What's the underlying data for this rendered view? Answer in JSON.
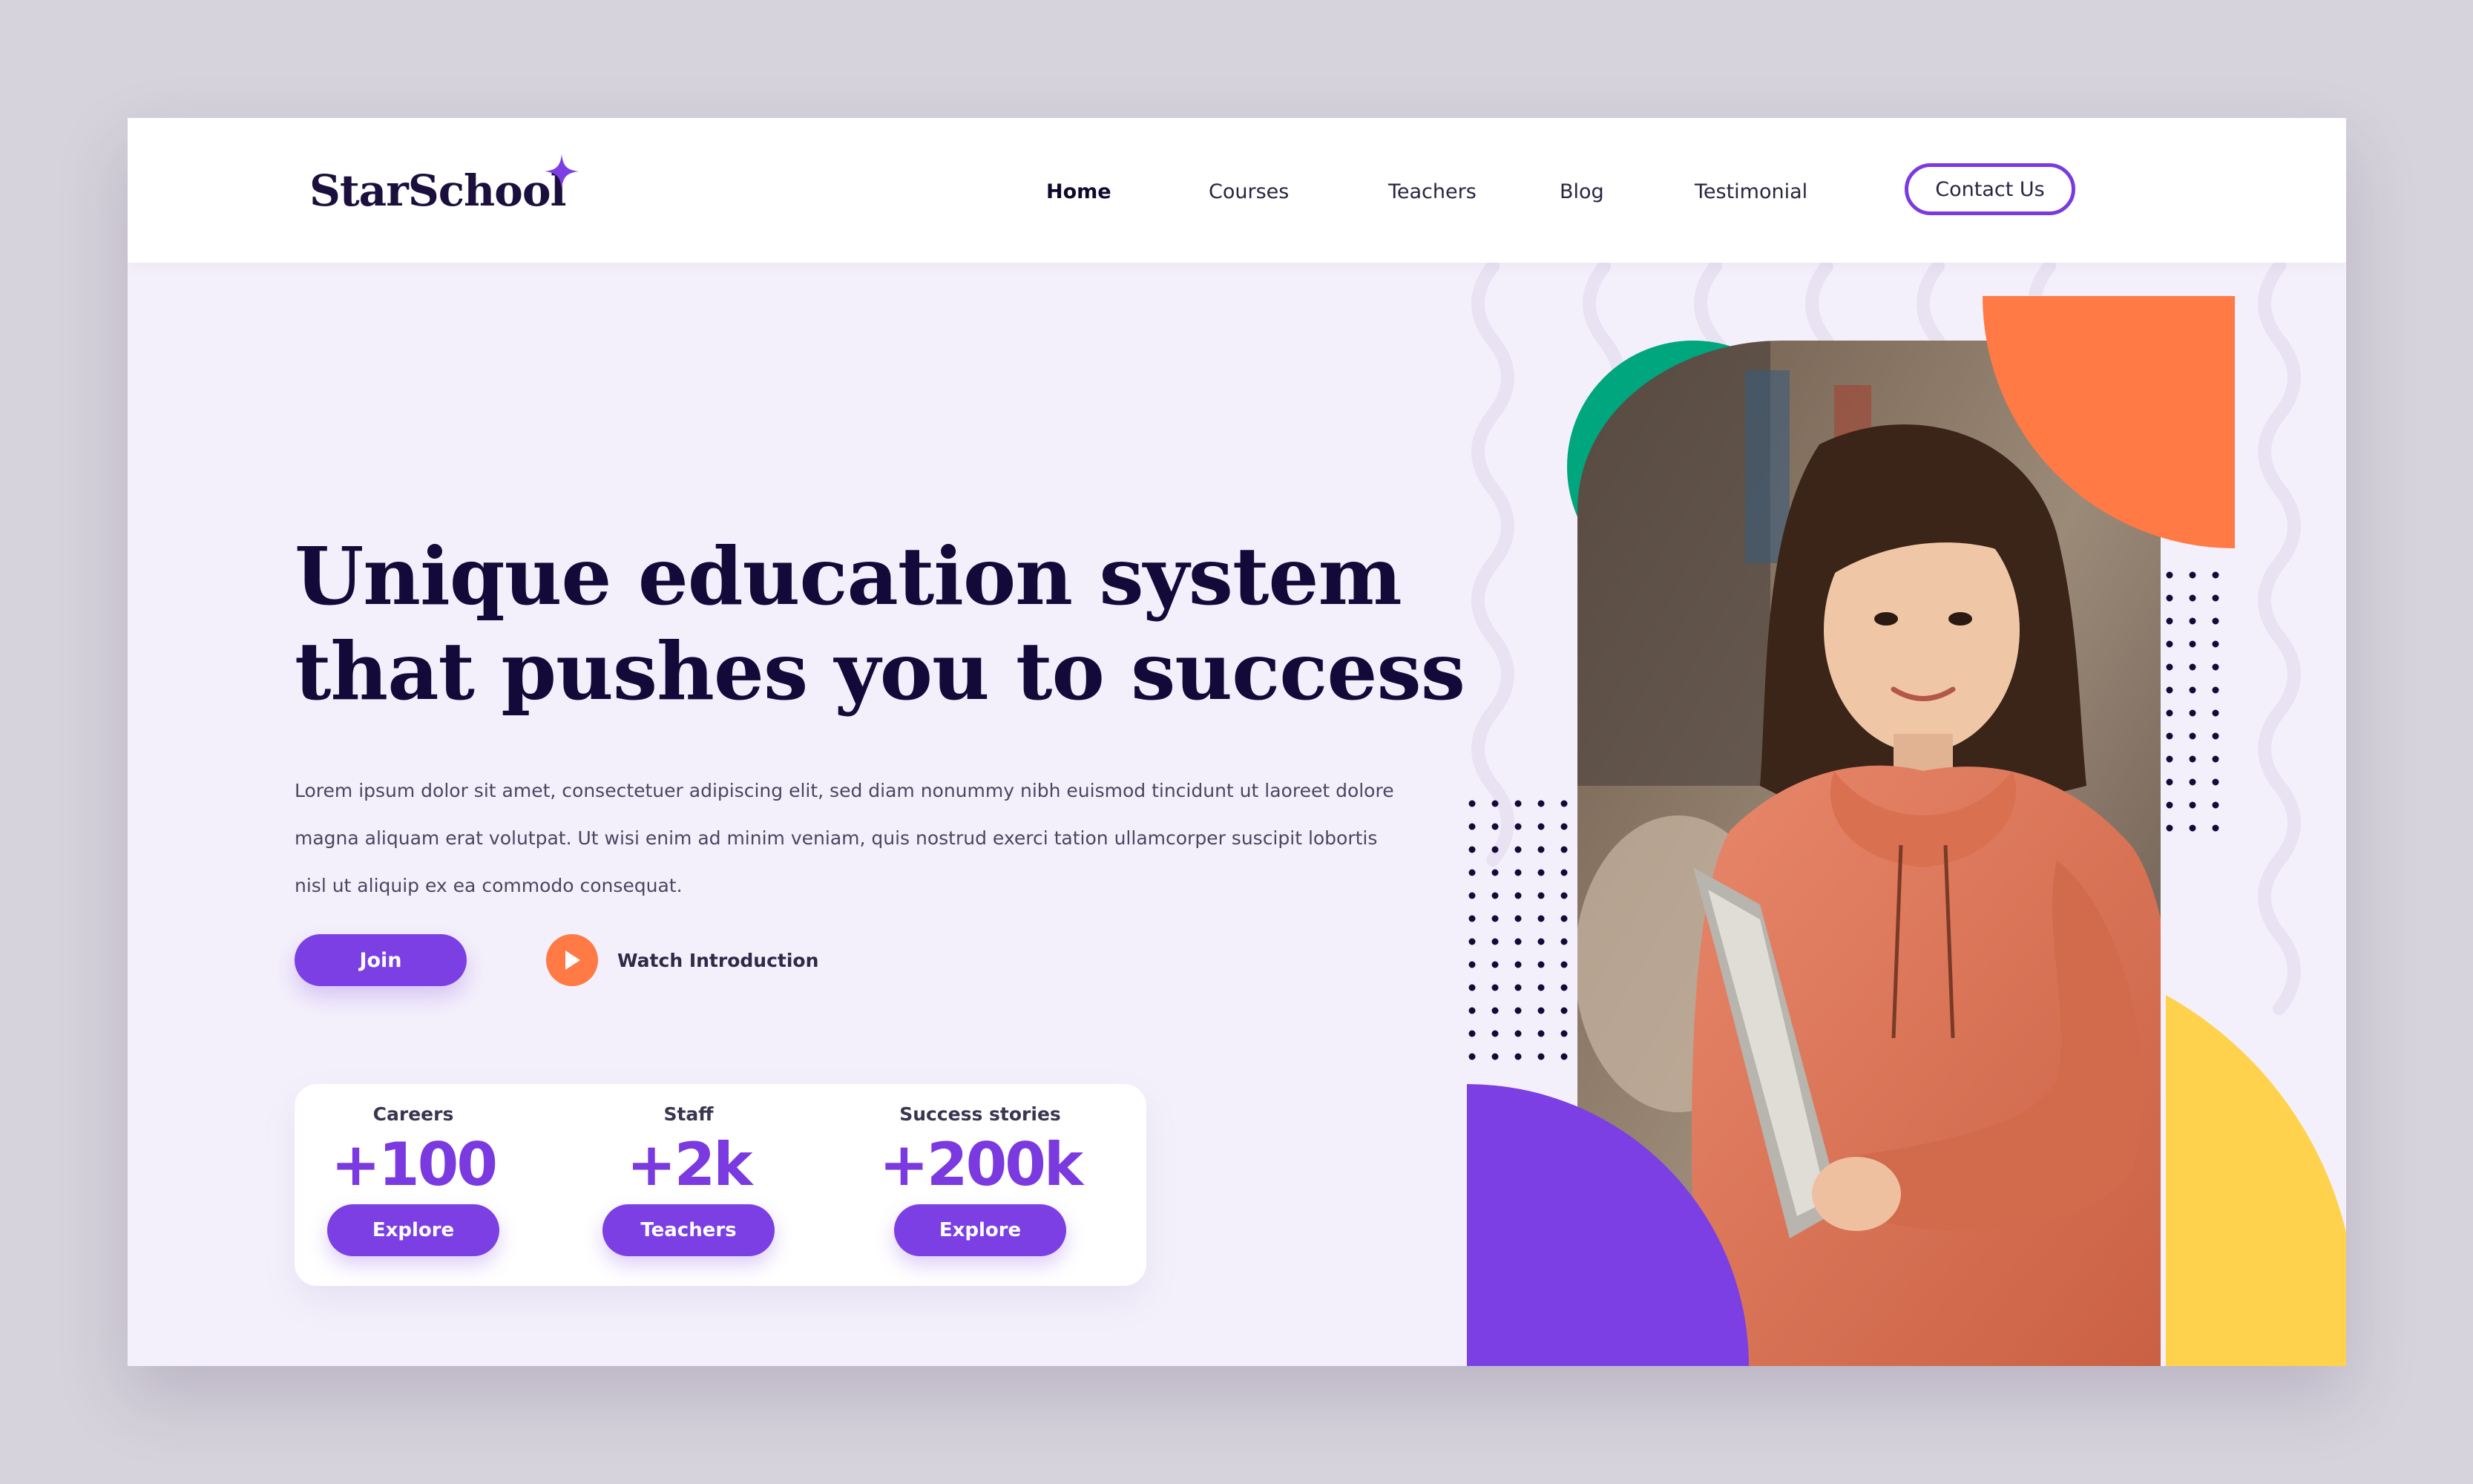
{
  "brand": {
    "name": "StarSchool"
  },
  "nav": {
    "items": [
      {
        "label": "Home",
        "active": true
      },
      {
        "label": "Courses",
        "active": false
      },
      {
        "label": "Teachers",
        "active": false
      },
      {
        "label": "Blog",
        "active": false
      },
      {
        "label": "Testimonial",
        "active": false
      }
    ],
    "contact_label": "Contact Us"
  },
  "hero": {
    "title_line1": "Unique education system",
    "title_line2": "that pushes you to success",
    "paragraph_line1": "Lorem ipsum dolor sit amet, consectetuer adipiscing elit, sed diam nonummy nibh euismod tincidunt ut laoreet dolore",
    "paragraph_line2": "magna aliquam erat volutpat. Ut wisi enim ad minim veniam, quis nostrud exerci tation ullamcorper suscipit lobortis",
    "paragraph_line3": "nisl ut aliquip ex ea commodo consequat.",
    "join_label": "Join",
    "watch_label": "Watch Introduction"
  },
  "stats": [
    {
      "label": "Careers",
      "value": "+100",
      "button": "Explore"
    },
    {
      "label": "Staff",
      "value": "+2k",
      "button": "Teachers"
    },
    {
      "label": "Success stories",
      "value": "+200k",
      "button": "Explore"
    }
  ],
  "colors": {
    "primary": "#7b3fe4",
    "navy": "#140a3a",
    "orange": "#ff7a45",
    "green": "#00a67e",
    "yellow": "#ffd24d",
    "background": "#f4f0fb"
  },
  "icons": {
    "logo_star": "four-point-star-icon",
    "play": "play-icon"
  }
}
